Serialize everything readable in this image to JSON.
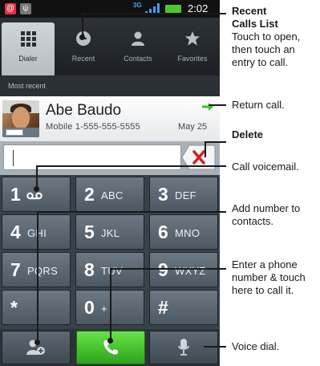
{
  "status_bar": {
    "network": "3G",
    "time": "2:02"
  },
  "tabs": [
    {
      "label": "Dialer",
      "icon": "grid-icon"
    },
    {
      "label": "Recent",
      "icon": "clock-icon"
    },
    {
      "label": "Contacts",
      "icon": "person-icon"
    },
    {
      "label": "Favorites",
      "icon": "star-icon"
    }
  ],
  "recent": {
    "header": "Most recent",
    "name": "Abe Baudo",
    "number": "Mobile 1-555-555-5555",
    "date": "May 25"
  },
  "keypad": [
    {
      "digit": "1",
      "letters": ""
    },
    {
      "digit": "2",
      "letters": "ABC"
    },
    {
      "digit": "3",
      "letters": "DEF"
    },
    {
      "digit": "4",
      "letters": "GHI"
    },
    {
      "digit": "5",
      "letters": "JKL"
    },
    {
      "digit": "6",
      "letters": "MNO"
    },
    {
      "digit": "7",
      "letters": "PQRS"
    },
    {
      "digit": "8",
      "letters": "TUV"
    },
    {
      "digit": "9",
      "letters": "WXYZ"
    },
    {
      "digit": "*",
      "letters": ""
    },
    {
      "digit": "0",
      "letters": "+"
    },
    {
      "digit": "#",
      "letters": ""
    }
  ],
  "annotations": {
    "recent_title": "Recent Calls List",
    "recent_desc": "Touch to open, then touch an entry to call.",
    "return_call": "Return call.",
    "delete": "Delete",
    "voicemail": "Call voicemail.",
    "add_contact": "Add number to contacts.",
    "enter_number": "Enter a phone number & touch here to call it.",
    "voice_dial": "Voice dial."
  },
  "colors": {
    "call_green": "#3cc22a",
    "delete_red": "#d32020",
    "battery_green": "#4ec72c"
  }
}
